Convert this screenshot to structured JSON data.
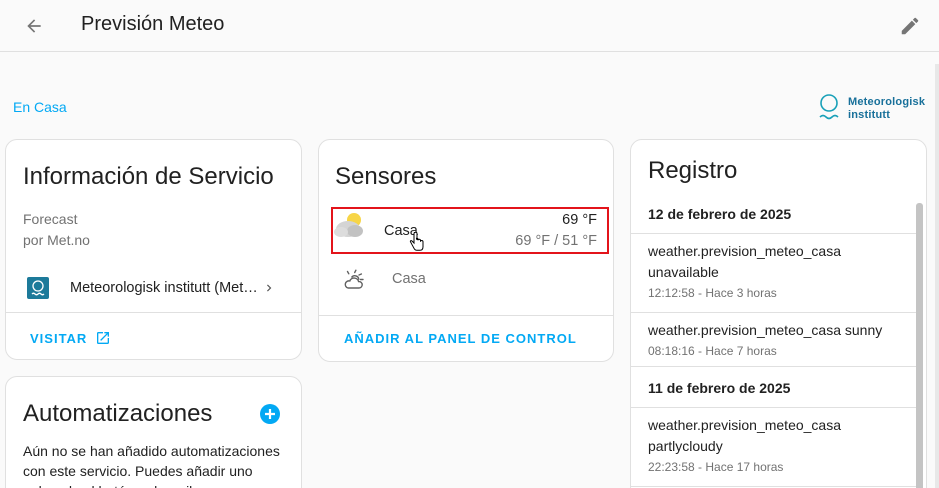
{
  "header": {
    "title": "Previsión Meteo",
    "back_icon": "arrow-left-icon",
    "edit_icon": "pencil-icon"
  },
  "area": {
    "label": "En Casa"
  },
  "brand": {
    "line1": "Meteorologisk",
    "line2": "institutt"
  },
  "service_info": {
    "title": "Información de Servicio",
    "desc_line1": "Forecast",
    "desc_line2": "por Met.no",
    "provider": "Meteorologisk institutt (Met.no)",
    "visit_label": "VISITAR"
  },
  "sensors": {
    "title": "Sensores",
    "items": [
      {
        "name": "Casa",
        "temp": "69 °F",
        "range": "69 °F / 51 °F",
        "icon": "partly-cloudy-icon"
      },
      {
        "name": "Casa",
        "icon": "weather-partly-cloudy-outline-icon"
      }
    ],
    "add_label": "AÑADIR AL PANEL DE CONTROL"
  },
  "logbook": {
    "title": "Registro",
    "groups": [
      {
        "date": "12 de febrero de 2025",
        "entries": [
          {
            "line1": "weather.prevision_meteo_casa",
            "line2": "unavailable",
            "meta": "12:12:58 - Hace 3 horas"
          },
          {
            "line1": "weather.prevision_meteo_casa sunny",
            "line2": "",
            "meta": "08:18:16 - Hace 7 horas"
          }
        ]
      },
      {
        "date": "11 de febrero de 2025",
        "entries": [
          {
            "line1": "weather.prevision_meteo_casa",
            "line2": "partlycloudy",
            "meta": "22:23:58 - Hace 17 horas"
          }
        ]
      }
    ]
  },
  "automations": {
    "title": "Automatizaciones",
    "text": "Aún no se han añadido automatizaciones con este servicio. Puedes añadir uno pulsando el botón + de arriba."
  },
  "colors": {
    "accent": "#03a9f4",
    "highlight": "#e3141b",
    "brand": "#1c7a9a"
  }
}
